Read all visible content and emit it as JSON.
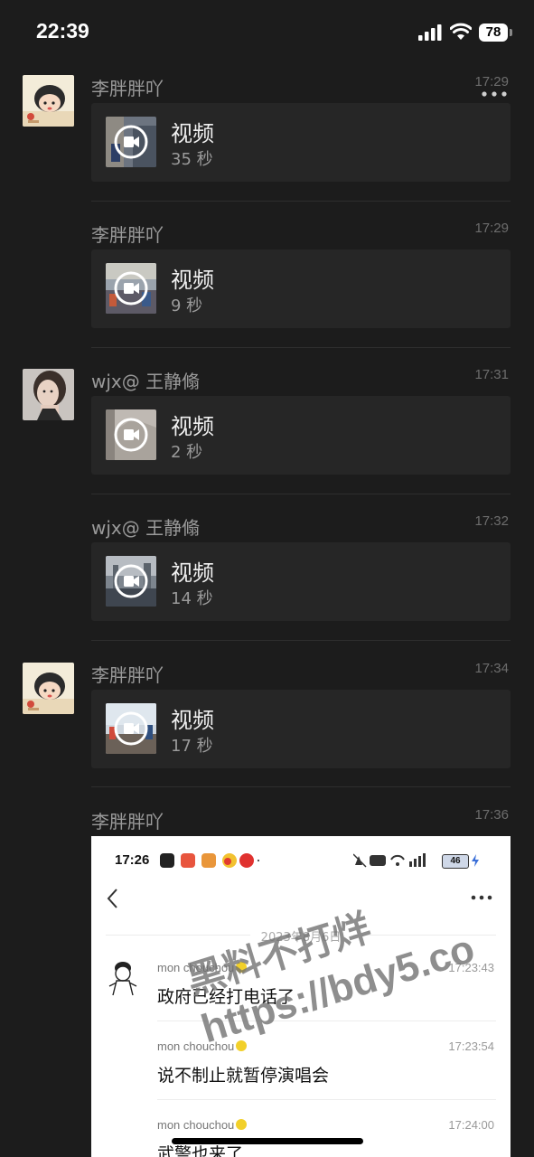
{
  "status_bar": {
    "time": "22:39",
    "battery": "78",
    "icons": [
      "signal-icon",
      "wifi-icon",
      "battery-icon"
    ]
  },
  "header": {
    "more_icon": "more-horizontal-icon"
  },
  "messages": [
    {
      "sender": "李胖胖吖",
      "time": "17:29",
      "title": "视频",
      "duration": "35 秒",
      "avatar": "cartoon-girl-avatar"
    },
    {
      "sender": "李胖胖吖",
      "time": "17:29",
      "title": "视频",
      "duration": "9 秒"
    },
    {
      "sender": "wjx@ 王静翛",
      "time": "17:31",
      "title": "视频",
      "duration": "2 秒",
      "avatar": "woman-photo-avatar"
    },
    {
      "sender": "wjx@ 王静翛",
      "time": "17:32",
      "title": "视频",
      "duration": "14 秒"
    },
    {
      "sender": "李胖胖吖",
      "time": "17:34",
      "title": "视频",
      "duration": "17 秒",
      "avatar": "cartoon-girl-avatar"
    },
    {
      "sender": "李胖胖吖",
      "time": "17:36"
    }
  ],
  "screenshot": {
    "status_time": "17:26",
    "battery": "46",
    "date": "2023年8月6日",
    "chat": [
      {
        "name": "mon chouchou",
        "time": "17:23:43",
        "text": "政府已经打电话了"
      },
      {
        "name": "mon chouchou",
        "time": "17:23:54",
        "text": "说不制止就暂停演唱会"
      },
      {
        "name": "mon chouchou",
        "time": "17:24:00",
        "text": "武警也来了"
      }
    ]
  },
  "watermark": {
    "line1": "黑料不打烊",
    "line2": "https://bdy5.co"
  }
}
